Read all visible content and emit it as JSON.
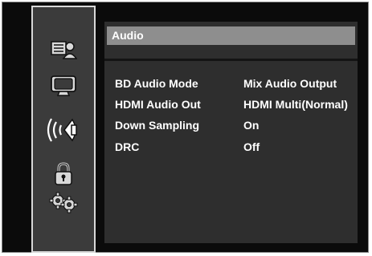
{
  "sidebar": {
    "items": [
      {
        "icon": "disc-player-person-icon",
        "selected": false
      },
      {
        "icon": "monitor-icon",
        "selected": false
      },
      {
        "icon": "audio-speaker-icon",
        "selected": true
      },
      {
        "icon": "lock-icon",
        "selected": false
      },
      {
        "icon": "gears-icon",
        "selected": false
      }
    ]
  },
  "panel": {
    "title": "Audio",
    "rows": [
      {
        "label": "BD Audio Mode",
        "value": "Mix Audio Output"
      },
      {
        "label": "HDMI Audio Out",
        "value": "HDMI Multi(Normal)"
      },
      {
        "label": "Down Sampling",
        "value": "On"
      },
      {
        "label": "DRC",
        "value": "Off"
      }
    ]
  },
  "colors": {
    "background": "#0b0b0b",
    "sidebar": "#3b3b3b",
    "panel": "#2e2e2e",
    "title_bar": "#8e8e8e",
    "text": "#ffffff"
  }
}
